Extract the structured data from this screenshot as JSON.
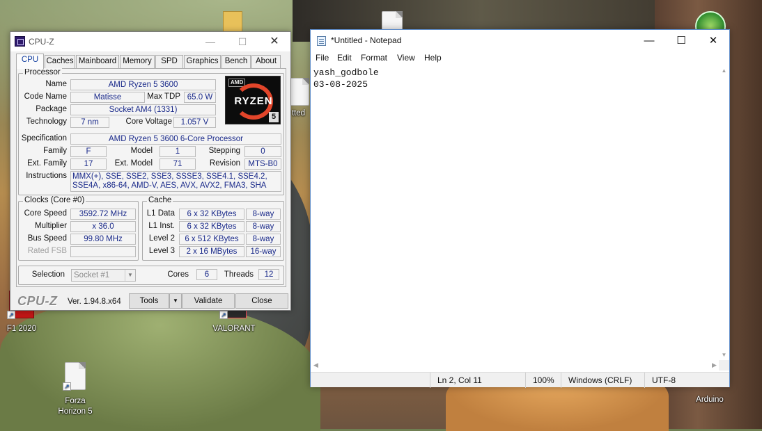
{
  "desktop": {
    "icons": [
      {
        "label": "F1 2020"
      },
      {
        "label": "VALORANT"
      },
      {
        "label": "Forza Horizon 5"
      },
      {
        "label": "Arduino"
      },
      {
        "label": "tted"
      }
    ]
  },
  "cpuz": {
    "title": "CPU-Z",
    "tabs": [
      "CPU",
      "Caches",
      "Mainboard",
      "Memory",
      "SPD",
      "Graphics",
      "Bench",
      "About"
    ],
    "active_tab": "CPU",
    "processor": {
      "group_title": "Processor",
      "name_label": "Name",
      "name": "AMD Ryzen 5 3600",
      "codename_label": "Code Name",
      "codename": "Matisse",
      "maxtdp_label": "Max TDP",
      "maxtdp": "65.0 W",
      "package_label": "Package",
      "package": "Socket AM4 (1331)",
      "technology_label": "Technology",
      "technology": "7 nm",
      "corevoltage_label": "Core Voltage",
      "corevoltage": "1.057 V",
      "spec_label": "Specification",
      "spec": "AMD Ryzen 5 3600 6-Core Processor",
      "family_label": "Family",
      "family": "F",
      "model_label": "Model",
      "model": "1",
      "stepping_label": "Stepping",
      "stepping": "0",
      "extfamily_label": "Ext. Family",
      "extfamily": "17",
      "extmodel_label": "Ext. Model",
      "extmodel": "71",
      "revision_label": "Revision",
      "revision": "MTS-B0",
      "instructions_label": "Instructions",
      "instructions": "MMX(+), SSE, SSE2, SSE3, SSSE3, SSE4.1, SSE4.2, SSE4A, x86-64, AMD-V, AES, AVX, AVX2, FMA3, SHA",
      "logo": {
        "brand": "AMD",
        "word": "RYZEN",
        "number": "5"
      }
    },
    "clocks": {
      "group_title": "Clocks (Core #0)",
      "corespeed_label": "Core Speed",
      "corespeed": "3592.72 MHz",
      "multiplier_label": "Multiplier",
      "multiplier": "x 36.0",
      "busspeed_label": "Bus Speed",
      "busspeed": "99.80 MHz",
      "ratedfsb_label": "Rated FSB",
      "ratedfsb": ""
    },
    "cache": {
      "group_title": "Cache",
      "rows": [
        {
          "label": "L1 Data",
          "size": "6 x 32 KBytes",
          "way": "8-way"
        },
        {
          "label": "L1 Inst.",
          "size": "6 x 32 KBytes",
          "way": "8-way"
        },
        {
          "label": "Level 2",
          "size": "6 x 512 KBytes",
          "way": "8-way"
        },
        {
          "label": "Level 3",
          "size": "2 x 16 MBytes",
          "way": "16-way"
        }
      ]
    },
    "selection": {
      "label": "Selection",
      "value": "Socket #1",
      "cores_label": "Cores",
      "cores": "6",
      "threads_label": "Threads",
      "threads": "12"
    },
    "footer": {
      "brand": "CPU-Z",
      "version": "Ver. 1.94.8.x64",
      "tools_label": "Tools",
      "validate_label": "Validate",
      "close_label": "Close"
    }
  },
  "notepad": {
    "title": "*Untitled - Notepad",
    "menu": [
      "File",
      "Edit",
      "Format",
      "View",
      "Help"
    ],
    "content": "yash_godbole\n03-08-2025",
    "status": {
      "position": "Ln 2, Col 11",
      "zoom": "100%",
      "line_ending": "Windows (CRLF)",
      "encoding": "UTF-8"
    }
  }
}
